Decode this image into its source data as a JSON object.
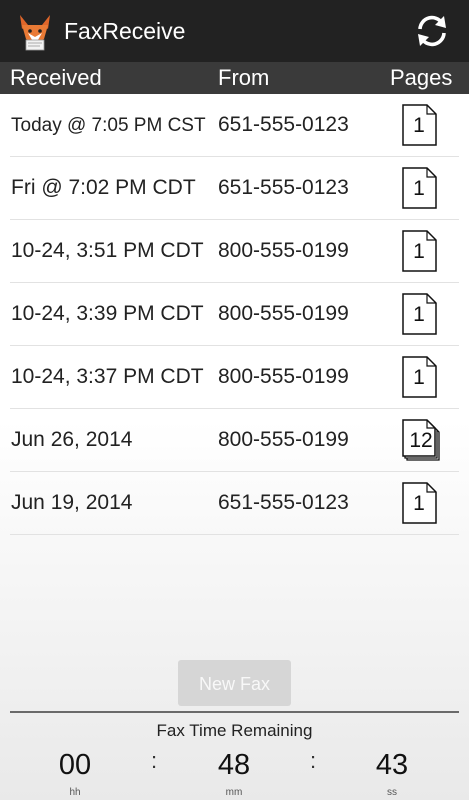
{
  "app": {
    "title": "FaxReceive",
    "icon": "fox-mascot-icon",
    "refresh_icon": "refresh-icon"
  },
  "columns": {
    "received": "Received",
    "from": "From",
    "pages": "Pages"
  },
  "faxes": [
    {
      "received": "Today @ 7:05 PM CST",
      "from": "651-555-0123",
      "pages": "1",
      "page_icon": "single-page-icon"
    },
    {
      "received": "Fri @ 7:02 PM CDT",
      "from": "651-555-0123",
      "pages": "1",
      "page_icon": "single-page-icon"
    },
    {
      "received": "10-24, 3:51 PM CDT",
      "from": "800-555-0199",
      "pages": "1",
      "page_icon": "single-page-icon"
    },
    {
      "received": "10-24, 3:39 PM CDT",
      "from": "800-555-0199",
      "pages": "1",
      "page_icon": "single-page-icon"
    },
    {
      "received": "10-24, 3:37 PM CDT",
      "from": "800-555-0199",
      "pages": "1",
      "page_icon": "single-page-icon"
    },
    {
      "received": "Jun 26, 2014",
      "from": "800-555-0199",
      "pages": "12",
      "page_icon": "multi-page-icon"
    },
    {
      "received": "Jun 19, 2014",
      "from": "651-555-0123",
      "pages": "1",
      "page_icon": "single-page-icon"
    }
  ],
  "new_fax_button": "New Fax",
  "timer": {
    "title": "Fax Time Remaining",
    "hours": "00",
    "minutes": "48",
    "seconds": "43",
    "hours_unit": "hh",
    "minutes_unit": "mm",
    "seconds_unit": "ss",
    "separator": ":"
  },
  "colors": {
    "action_bar": "#222222",
    "column_header": "#3a3a3a",
    "button_disabled": "#d6d6d6"
  }
}
